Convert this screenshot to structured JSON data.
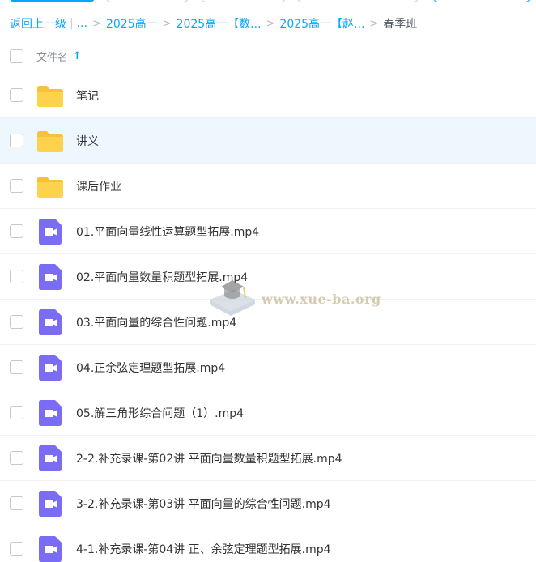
{
  "breadcrumb": {
    "back_label": "返回上一级",
    "ellipsis": "...",
    "items": [
      {
        "label": "2025高一"
      },
      {
        "label": "2025高一【数..."
      },
      {
        "label": "2025高一【赵..."
      }
    ],
    "current": "春季班"
  },
  "list_header": {
    "column_name": "文件名",
    "sort_icon": "arrow-up-icon"
  },
  "files": [
    {
      "name": "笔记",
      "type": "folder",
      "icon": "folder-icon"
    },
    {
      "name": "讲义",
      "type": "folder",
      "icon": "folder-icon"
    },
    {
      "name": "课后作业",
      "type": "folder",
      "icon": "folder-icon"
    },
    {
      "name": "01.平面向量线性运算题型拓展.mp4",
      "type": "video",
      "icon": "video-file-icon"
    },
    {
      "name": "02.平面向量数量积题型拓展.mp4",
      "type": "video",
      "icon": "video-file-icon"
    },
    {
      "name": "03.平面向量的综合性问题.mp4",
      "type": "video",
      "icon": "video-file-icon"
    },
    {
      "name": "04.正余弦定理题型拓展.mp4",
      "type": "video",
      "icon": "video-file-icon"
    },
    {
      "name": "05.解三角形综合问题（1）.mp4",
      "type": "video",
      "icon": "video-file-icon"
    },
    {
      "name": "2-2.补充录课-第02讲 平面向量数量积题型拓展.mp4",
      "type": "video",
      "icon": "video-file-icon"
    },
    {
      "name": "3-2.补充录课-第03讲 平面向量的综合性问题.mp4",
      "type": "video",
      "icon": "video-file-icon"
    },
    {
      "name": "4-1.补充录课-第04讲 正、余弦定理题型拓展.mp4",
      "type": "video",
      "icon": "video-file-icon"
    }
  ],
  "watermark": {
    "text": "www.xue-ba.org"
  },
  "colors": {
    "accent": "#06a7ff",
    "folder": "#ffd24d",
    "video": "#7b6cf6",
    "hover_row": "#eef7fd"
  }
}
